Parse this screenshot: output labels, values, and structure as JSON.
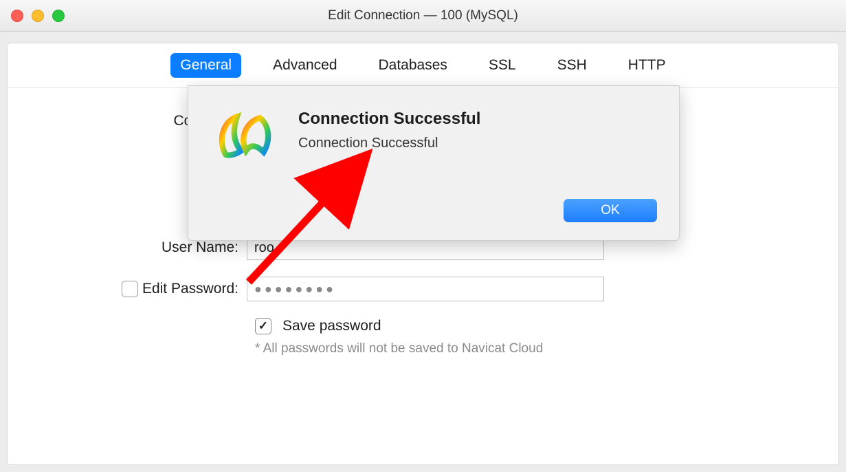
{
  "window": {
    "title": "Edit Connection — 100 (MySQL)"
  },
  "tabs": {
    "general": "General",
    "advanced": "Advanced",
    "databases": "Databases",
    "ssl": "SSL",
    "ssh": "SSH",
    "http": "HTTP",
    "active": "general"
  },
  "form": {
    "connection_name_label": "Connectio",
    "user_name_label": "User Name:",
    "user_name_value": "roo",
    "edit_password_label": "Edit Password:",
    "edit_password_checked": false,
    "password_mask": "●●●●●●●●",
    "save_password_label": "Save password",
    "save_password_checked": true,
    "hint": "* All passwords will not be saved to Navicat Cloud"
  },
  "dialog": {
    "title": "Connection Successful",
    "message": "Connection Successful",
    "ok_label": "OK"
  },
  "icons": {
    "app_icon": "navicat-logo-icon"
  }
}
